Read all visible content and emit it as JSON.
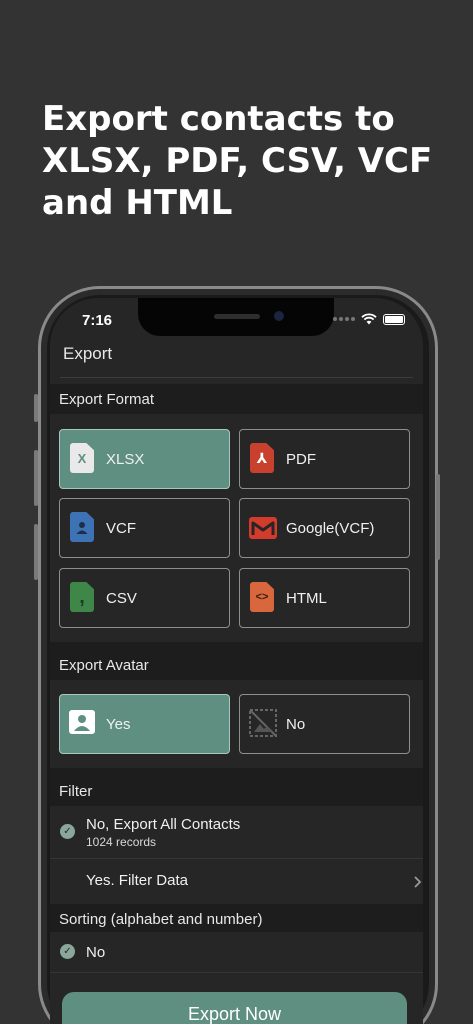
{
  "headline": {
    "line1": "Export contacts to",
    "line2": "XLSX, PDF, CSV, VCF",
    "line3": "and HTML"
  },
  "status_bar": {
    "time": "7:16"
  },
  "nav": {
    "title": "Export"
  },
  "export_format": {
    "header": "Export Format",
    "options": [
      {
        "label": "XLSX",
        "icon": "xlsx-file-icon",
        "selected": true
      },
      {
        "label": "PDF",
        "icon": "pdf-file-icon",
        "selected": false
      },
      {
        "label": "VCF",
        "icon": "vcf-file-icon",
        "selected": false
      },
      {
        "label": "Google(VCF)",
        "icon": "gmail-icon",
        "selected": false
      },
      {
        "label": "CSV",
        "icon": "csv-file-icon",
        "selected": false
      },
      {
        "label": "HTML",
        "icon": "html-file-icon",
        "selected": false
      }
    ]
  },
  "export_avatar": {
    "header": "Export Avatar",
    "options": [
      {
        "label": "Yes",
        "icon": "contact-card-icon",
        "selected": true
      },
      {
        "label": "No",
        "icon": "no-image-icon",
        "selected": false
      }
    ]
  },
  "filter": {
    "header": "Filter",
    "all_contacts": {
      "title": "No, Export All Contacts",
      "subtitle": "1024 records",
      "checked": true
    },
    "filter_data": {
      "title": "Yes. Filter Data"
    }
  },
  "sorting": {
    "header": "Sorting (alphabet and number)",
    "option": {
      "label": "No",
      "checked": true
    }
  },
  "export_button": {
    "label": "Export Now"
  },
  "colors": {
    "background": "#333333",
    "accent": "#5f8f80",
    "xlsx": "#5f8f80",
    "pdf": "#c8412e",
    "vcf": "#3d72b4",
    "gmail": "#d33b2c",
    "csv": "#3e8748",
    "html": "#d9673d"
  }
}
